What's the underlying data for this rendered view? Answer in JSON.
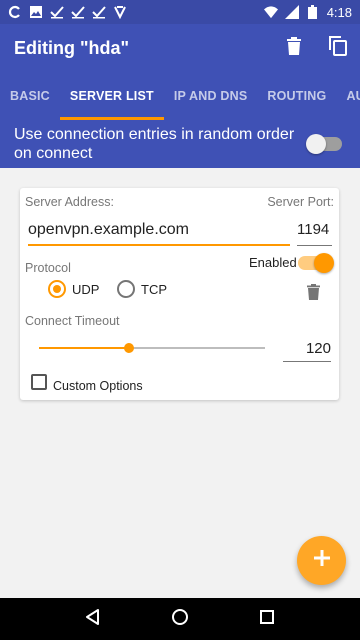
{
  "status_bar": {
    "time": "4:18",
    "left_icons": [
      "sync-icon",
      "image-icon",
      "check-icon",
      "check-icon",
      "check-icon",
      "vpn-icon"
    ],
    "right_icons": [
      "wifi-icon",
      "signal-icon",
      "battery-icon"
    ]
  },
  "app_bar": {
    "title": "Editing \"hda\"",
    "actions": [
      "delete-icon",
      "copy-icon"
    ]
  },
  "tabs": [
    {
      "label": "BASIC",
      "active": false
    },
    {
      "label": "SERVER LIST",
      "active": true
    },
    {
      "label": "IP AND DNS",
      "active": false
    },
    {
      "label": "ROUTING",
      "active": false
    },
    {
      "label": "AUTHEN",
      "active": false
    }
  ],
  "random_order": {
    "label": "Use connection entries in random order on connect",
    "enabled": false
  },
  "server_entry": {
    "server_address_label": "Server Address:",
    "server_address_value": "openvpn.example.com",
    "server_port_label": "Server Port:",
    "server_port_value": "1194",
    "enabled_label": "Enabled",
    "enabled": true,
    "protocol_label": "Protocol",
    "protocol_options": [
      {
        "label": "UDP",
        "selected": true
      },
      {
        "label": "TCP",
        "selected": false
      }
    ],
    "connect_timeout_label": "Connect Timeout",
    "connect_timeout_value": "120",
    "slider_fraction": 0.4,
    "custom_options_label": "Custom Options",
    "custom_options_checked": false
  },
  "fab_icon": "plus-icon",
  "nav_bar": [
    "back-icon",
    "home-icon",
    "recents-icon"
  ],
  "colors": {
    "primary": "#3f51b5",
    "primary_dark": "#3a4aa6",
    "accent": "#ff9800",
    "fab": "#ffa726"
  }
}
